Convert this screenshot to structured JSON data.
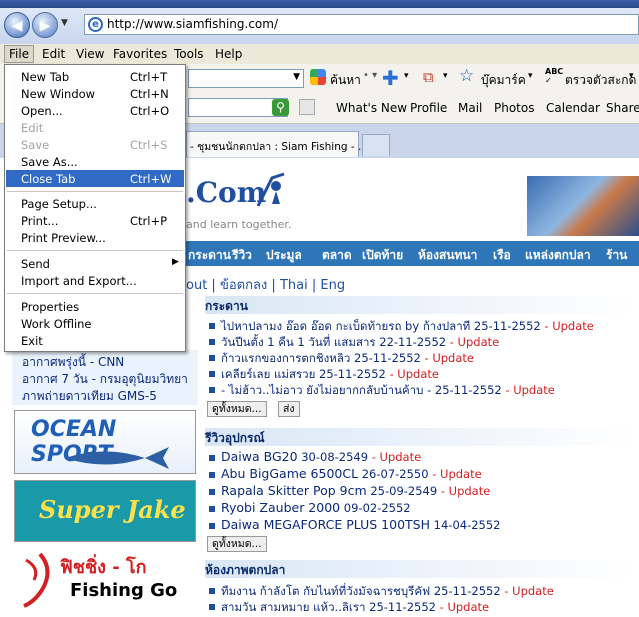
{
  "browser": {
    "address_url": "http://www.siamfishing.com/",
    "menus": [
      "File",
      "Edit",
      "View",
      "Favorites",
      "Tools",
      "Help"
    ],
    "search_label": "ค้นหา",
    "bookmarks_label": "บุ๊คมาร์ค",
    "spellcheck_label": "ตรวจตัวสะกด",
    "toolbar_links": [
      "What's New",
      "Profile",
      "Mail",
      "Photos",
      "Calendar",
      "Share"
    ],
    "tab_title": "- ชุมชนนักตกปลา : Siam Fishing - ..."
  },
  "file_menu": {
    "items": [
      {
        "label": "New Tab",
        "shortcut": "Ctrl+T"
      },
      {
        "label": "New Window",
        "shortcut": "Ctrl+N"
      },
      {
        "label": "Open...",
        "shortcut": "Ctrl+O"
      },
      {
        "label": "Edit",
        "shortcut": ""
      },
      {
        "label": "Save",
        "shortcut": "Ctrl+S"
      },
      {
        "label": "Save As...",
        "shortcut": ""
      },
      {
        "label": "Close Tab",
        "shortcut": "Ctrl+W"
      },
      {
        "label": "Page Setup...",
        "shortcut": ""
      },
      {
        "label": "Print...",
        "shortcut": "Ctrl+P"
      },
      {
        "label": "Print Preview...",
        "shortcut": ""
      },
      {
        "label": "Send",
        "shortcut": ""
      },
      {
        "label": "Import and Export...",
        "shortcut": ""
      },
      {
        "label": "Properties",
        "shortcut": ""
      },
      {
        "label": "Work Offline",
        "shortcut": ""
      },
      {
        "label": "Exit",
        "shortcut": ""
      }
    ]
  },
  "site": {
    "logo_text": ".Com",
    "tagline": "and learn together.",
    "nav": [
      "กระดาน",
      "รีวิว",
      "ประมูล",
      "ตลาด",
      "เปิดท้าย",
      "ห้องสนทนา",
      "เรือ",
      "แหล่งตกปลา",
      "ร้านค้า"
    ],
    "lang_bar": {
      "left": "out",
      "agree": "ข้อตกลง",
      "thai": "Thai",
      "eng": "Eng"
    },
    "left_links": [
      "อากาศพรุ่งนี้ - CNN",
      "อากาศ 7 วัน - กรมอุตุนิยมวิทยา",
      "ภาพถ่ายดาวเทียม GMS-5"
    ],
    "banners": {
      "ocean_sport": "OCEAN SPORT",
      "super_jake": "Super Jake",
      "fishing_go_thai": "ฟิชชิ่ง - โก",
      "fishing_go": "Fishing Go"
    },
    "board": {
      "title": "กระดาน",
      "items": [
        {
          "text": "ไปหาปลามง อ๊อด อ๊อด กะเบ็ดท้ายรถ by ก้างปลาที",
          "date": "25-11-2552",
          "update": "- Update"
        },
        {
          "text": "วันปีนตั้ง 1 คืน 1 วันที่ แสมสาร",
          "date": "22-11-2552",
          "update": "- Update"
        },
        {
          "text": "ก้าวแรกของการตกชิงหลิว",
          "date": "25-11-2552",
          "update": "- Update"
        },
        {
          "text": "เคลียร์เลย แม่สรวย",
          "date": "25-11-2552",
          "update": "- Update"
        },
        {
          "text": "- ไม่ฮ้าว..ไม่อาว ยังไม่อยากกลับบ้านค้าบ -",
          "date": "25-11-2552",
          "update": "- Update"
        }
      ],
      "view_all": "ดูทั้งหมด...",
      "post": "ส่ง"
    },
    "review": {
      "title": "รีวิวอุปกรณ์",
      "items": [
        {
          "text": "Daiwa BG20",
          "date": "30-08-2549",
          "update": "- Update"
        },
        {
          "text": "Abu BigGame 6500CL",
          "date": "26-07-2550",
          "update": "- Update"
        },
        {
          "text": "Rapala Skitter Pop 9cm",
          "date": "25-09-2549",
          "update": "- Update"
        },
        {
          "text": "Ryobi Zauber 2000",
          "date": "09-02-2552",
          "update": ""
        },
        {
          "text": "Daiwa MEGAFORCE PLUS 100TSH",
          "date": "14-04-2552",
          "update": ""
        }
      ],
      "view_all": "ดูทั้งหมด..."
    },
    "photos": {
      "title": "ห้องภาพตกปลา",
      "items": [
        {
          "text": "ทีมงาน ก้าลังโต กับไนท์ที่วังมัจฉารชบุรีคัฟ",
          "date": "25-11-2552",
          "update": "- Update"
        },
        {
          "text": "สามวัน สามหมาย แห้ว..ลิเรา",
          "date": "25-11-2552",
          "update": "- Update"
        }
      ]
    }
  },
  "colors": {
    "menu_highlight": "#316ac5",
    "nav_blue": "#2f76b8",
    "update_red": "#d02020",
    "link_blue": "#0a2a7a"
  }
}
